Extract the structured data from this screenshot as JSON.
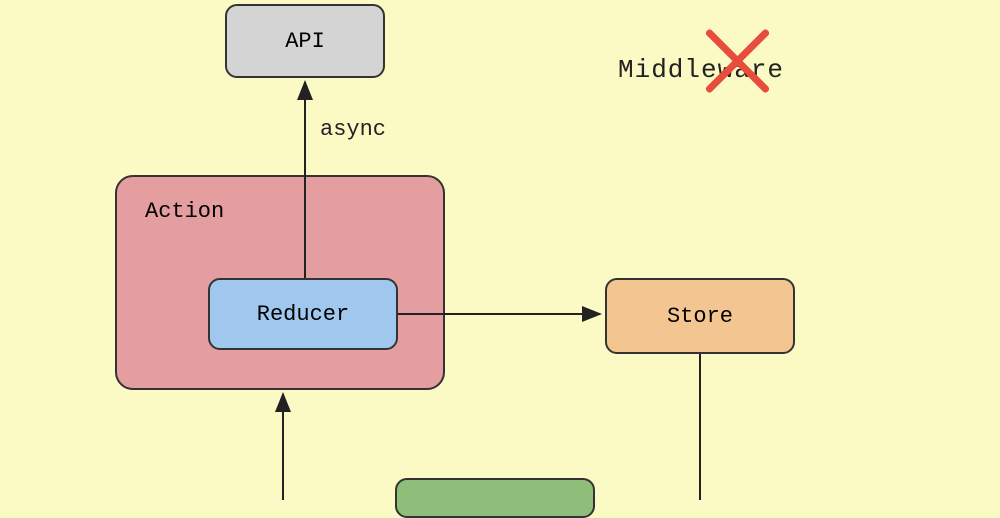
{
  "nodes": {
    "api": "API",
    "action": "Action",
    "reducer": "Reducer",
    "store": "Store",
    "middleware": "Middleware"
  },
  "labels": {
    "async": "async"
  },
  "colors": {
    "background": "#fbfac4",
    "api": "#d4d4d4",
    "action": "#e59ea0",
    "reducer": "#a0c8ef",
    "store": "#f3c691",
    "green": "#8fbe7a",
    "cross": "#e84c3d"
  }
}
